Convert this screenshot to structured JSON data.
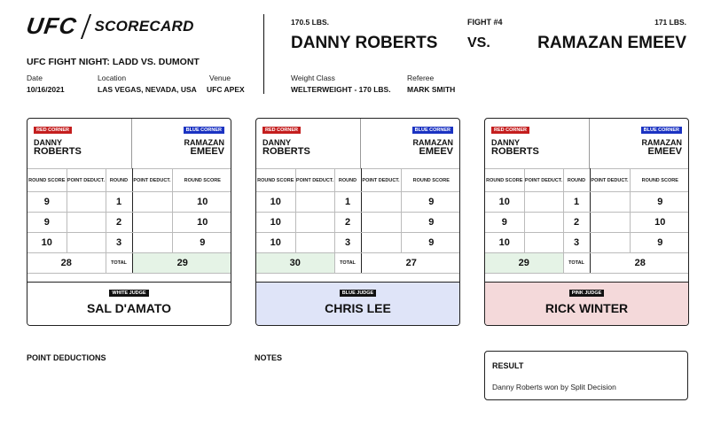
{
  "header": {
    "logo_text": "UFC",
    "title": "SCORECARD",
    "event_name": "UFC FIGHT NIGHT: LADD VS. DUMONT",
    "date_label": "Date",
    "date": "10/16/2021",
    "location_label": "Location",
    "location": "LAS VEGAS, NEVADA, USA",
    "venue_label": "Venue",
    "venue": "UFC APEX"
  },
  "fight": {
    "red_weight": "170.5 LBS.",
    "blue_weight": "171 LBS.",
    "fight_number": "FIGHT #4",
    "red_fighter": "DANNY ROBERTS",
    "vs": "VS.",
    "blue_fighter": "RAMAZAN EMEEV",
    "weight_class_label": "Weight Class",
    "weight_class": "WELTERWEIGHT - 170 LBS.",
    "referee_label": "Referee",
    "referee": "MARK SMITH"
  },
  "card_labels": {
    "red_corner": "RED CORNER",
    "blue_corner": "BLUE CORNER",
    "red_first": "DANNY",
    "red_last": "ROBERTS",
    "blue_first": "RAMAZAN",
    "blue_last": "EMEEV",
    "round_score": "ROUND SCORE",
    "point_deduct": "POINT DEDUCT.",
    "round": "ROUND",
    "total": "TOTAL"
  },
  "cards": [
    {
      "judge_badge": "WHITE JUDGE",
      "judge_name": "SAL D'AMATO",
      "judge_color": "#ffffff",
      "rounds": [
        {
          "round": "1",
          "red": "9",
          "blue": "10"
        },
        {
          "round": "2",
          "red": "9",
          "blue": "10"
        },
        {
          "round": "3",
          "red": "10",
          "blue": "9"
        }
      ],
      "red_total": "28",
      "blue_total": "29",
      "winner": "blue"
    },
    {
      "judge_badge": "BLUE JUDGE",
      "judge_name": "CHRIS LEE",
      "judge_color": "#dfe4f8",
      "rounds": [
        {
          "round": "1",
          "red": "10",
          "blue": "9"
        },
        {
          "round": "2",
          "red": "10",
          "blue": "9"
        },
        {
          "round": "3",
          "red": "10",
          "blue": "9"
        }
      ],
      "red_total": "30",
      "blue_total": "27",
      "winner": "red"
    },
    {
      "judge_badge": "PINK JUDGE",
      "judge_name": "RICK WINTER",
      "judge_color": "#f4d9da",
      "rounds": [
        {
          "round": "1",
          "red": "10",
          "blue": "9"
        },
        {
          "round": "2",
          "red": "9",
          "blue": "10"
        },
        {
          "round": "3",
          "red": "10",
          "blue": "9"
        }
      ],
      "red_total": "29",
      "blue_total": "28",
      "winner": "red"
    }
  ],
  "footer": {
    "point_deductions_label": "POINT DEDUCTIONS",
    "notes_label": "NOTES",
    "result_label": "RESULT",
    "result_text": "Danny Roberts won by Split Decision"
  },
  "colors": {
    "red_corner": "#c41e1e",
    "blue_corner": "#1b33c2",
    "winner_total": "#e5f3e6"
  }
}
